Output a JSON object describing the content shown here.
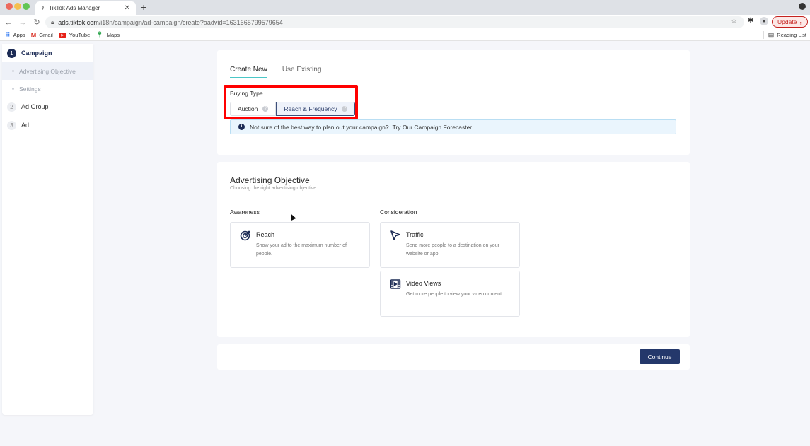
{
  "browser": {
    "tab_title": "TikTok Ads Manager",
    "url_host": "ads.tiktok.com",
    "url_path": "/i18n/campaign/ad-campaign/create?aadvid=1631665799579654",
    "update_label": "Update",
    "bookmarks": [
      {
        "label": "Apps",
        "icon": "apps-grid-icon"
      },
      {
        "label": "Gmail",
        "icon": "gmail-icon"
      },
      {
        "label": "YouTube",
        "icon": "youtube-icon"
      },
      {
        "label": "Maps",
        "icon": "maps-pin-icon"
      }
    ],
    "reading_list_label": "Reading List"
  },
  "sidebar": {
    "steps": [
      {
        "num": "1",
        "label": "Campaign",
        "state": "active"
      },
      {
        "num": "2",
        "label": "Ad Group",
        "state": "inactive"
      },
      {
        "num": "3",
        "label": "Ad",
        "state": "inactive"
      }
    ],
    "substeps": [
      {
        "label": "Advertising Objective",
        "selected": true
      },
      {
        "label": "Settings",
        "selected": false
      }
    ]
  },
  "campaign_source": {
    "tabs": [
      {
        "label": "Create New",
        "active": true
      },
      {
        "label": "Use Existing",
        "active": false
      }
    ],
    "buying_type_label": "Buying Type",
    "buying_options": [
      {
        "label": "Auction",
        "selected": false
      },
      {
        "label": "Reach & Frequency",
        "selected": true
      }
    ],
    "info_text": "Not sure of the best way to plan out your campaign?",
    "info_link": "Try Our Campaign Forecaster"
  },
  "objective": {
    "title": "Advertising Objective",
    "subtitle": "Choosing the right advertising objective",
    "columns": [
      {
        "label": "Awareness",
        "tiles": [
          {
            "title": "Reach",
            "desc": "Show your ad to the maximum number of people.",
            "icon": "target-icon"
          }
        ]
      },
      {
        "label": "Consideration",
        "tiles": [
          {
            "title": "Traffic",
            "desc": "Send more people to a destination on your website or app.",
            "icon": "cursor-arrow-icon"
          },
          {
            "title": "Video Views",
            "desc": "Get more people to view your video content.",
            "icon": "video-film-icon"
          }
        ]
      }
    ]
  },
  "footer": {
    "continue_label": "Continue"
  },
  "colors": {
    "accent": "#24386b",
    "tab_underline": "#4ac7c7",
    "highlight": "#ff0000"
  }
}
